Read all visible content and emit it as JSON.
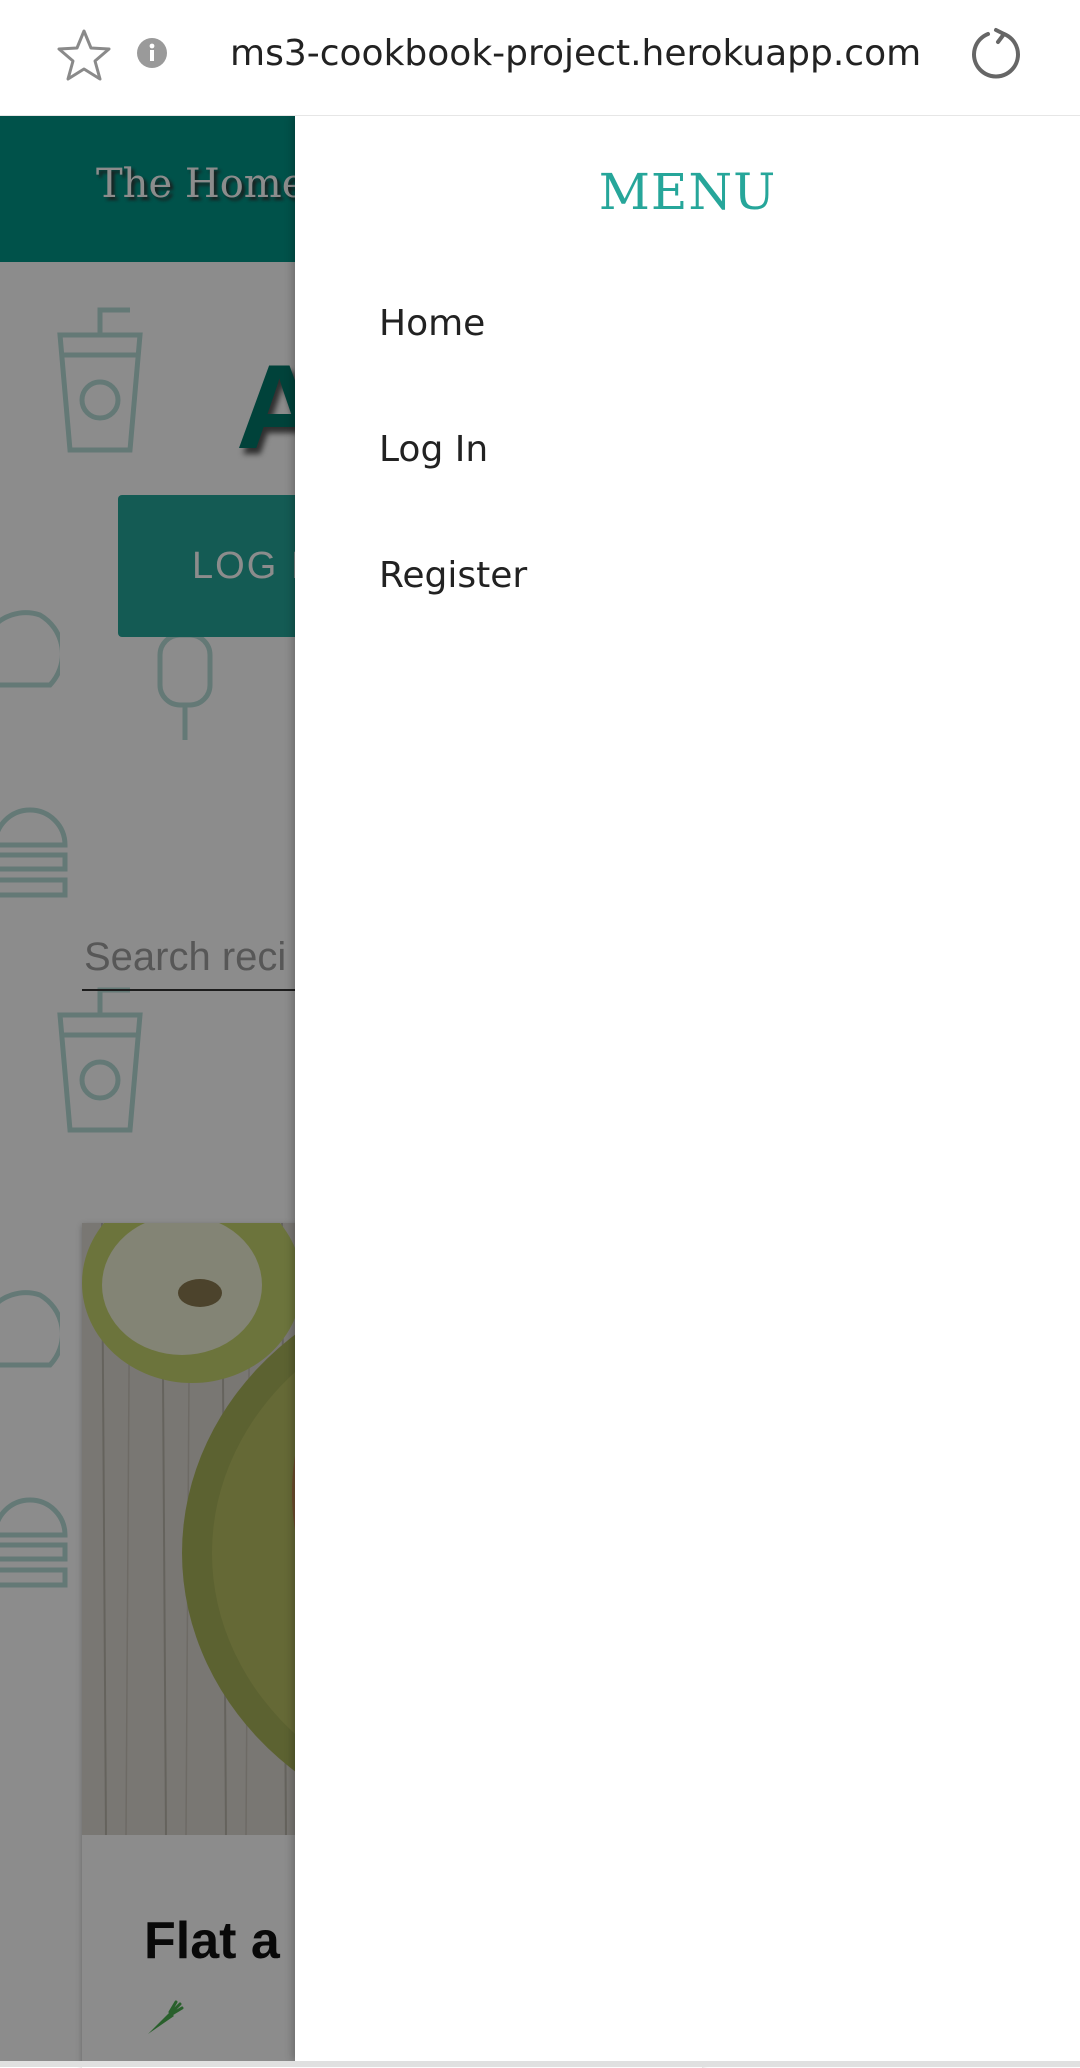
{
  "browser": {
    "url": "ms3-cookbook-project.herokuapp.com",
    "icons": [
      "star-icon",
      "info-icon",
      "reload-icon"
    ]
  },
  "navbar": {
    "brand": "The Home",
    "color": "#009688"
  },
  "hero": {
    "title_fragment": "A",
    "login_button": "LOG I"
  },
  "search": {
    "placeholder": "Search reci"
  },
  "recipe_card": {
    "title": "Flat a",
    "icon": "carrot-icon"
  },
  "drawer": {
    "title": "MENU",
    "accent": "#26a69a",
    "items": [
      {
        "label": "Home"
      },
      {
        "label": "Log In"
      },
      {
        "label": "Register"
      }
    ]
  }
}
